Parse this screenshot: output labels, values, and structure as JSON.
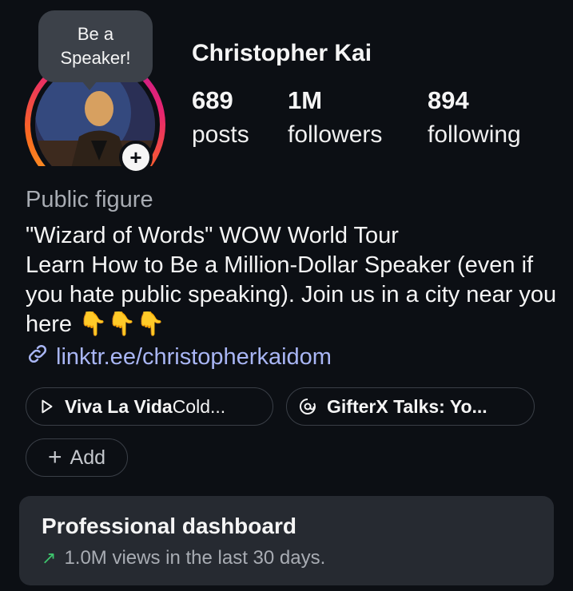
{
  "profile": {
    "tooltip_line1": "Be a",
    "tooltip_line2": "Speaker!",
    "name": "Christopher Kai",
    "stats": [
      {
        "value": "689",
        "label": "posts"
      },
      {
        "value": "1M",
        "label": "followers"
      },
      {
        "value": "894",
        "label": "following"
      }
    ],
    "category": "Public figure",
    "bio": "\"Wizard of Words\" WOW World Tour\nLearn How to Be a Million-Dollar Speaker (even if you hate public speaking). Join us in a city near you here 👇👇👇",
    "link": "linktr.ee/christopherkaidom"
  },
  "chips": [
    {
      "icon": "play-icon",
      "bold": "Viva La Vida",
      "rest": " Cold..."
    },
    {
      "icon": "threads-icon",
      "bold": "GifterX Talks: Yo...",
      "rest": ""
    }
  ],
  "add_chip": {
    "label": "Add"
  },
  "dashboard": {
    "title": "Professional dashboard",
    "subtitle": "1.0M views in the last 30 days."
  },
  "colors": {
    "background": "#0c0f14",
    "link": "#a9b6f5",
    "trend_up": "#3ec46d",
    "card": "#262a31"
  }
}
